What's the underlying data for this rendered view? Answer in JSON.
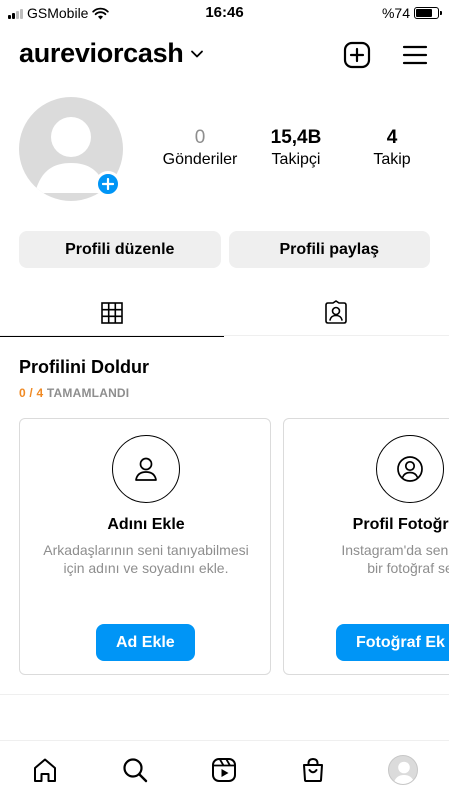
{
  "status_bar": {
    "carrier": "GSMobile",
    "time": "16:46",
    "battery": "%74",
    "battery_level": 0.74
  },
  "header": {
    "username": "aureviorcash",
    "icons": [
      "chevron-down-icon",
      "create-plus-icon",
      "menu-icon"
    ]
  },
  "profile": {
    "stats": [
      {
        "value": "0",
        "label": "Gönderiler"
      },
      {
        "value": "15,4B",
        "label": "Takipçi"
      },
      {
        "value": "4",
        "label": "Takip"
      }
    ],
    "edit_button": "Profili düzenle",
    "share_button": "Profili paylaş"
  },
  "tabs": [
    {
      "icon": "grid-icon",
      "active": true
    },
    {
      "icon": "tagged-icon",
      "active": false
    }
  ],
  "complete_profile": {
    "title": "Profilini Doldur",
    "progress_done": "0 / 4",
    "progress_label": "TAMAMLANDI",
    "cards": [
      {
        "icon": "person-icon",
        "title": "Adını Ekle",
        "desc_line1": "Arkadaşlarının seni tanıyabilmesi",
        "desc_line2": "için adını ve soyadını ekle.",
        "button": "Ad Ekle"
      },
      {
        "icon": "profile-photo-icon",
        "title": "Profil Fotoğrafı",
        "desc_line1": "Instagram'da seni tem",
        "desc_line2": "bir fotoğraf se",
        "button": "Fotoğraf Ek"
      }
    ]
  },
  "bottom_nav": [
    "home-icon",
    "search-icon",
    "reels-icon",
    "shop-icon",
    "profile-avatar"
  ],
  "colors": {
    "accent": "#0095f6",
    "progress": "#f08a24",
    "muted": "#8e8e8e",
    "button_bg": "#efefef"
  }
}
